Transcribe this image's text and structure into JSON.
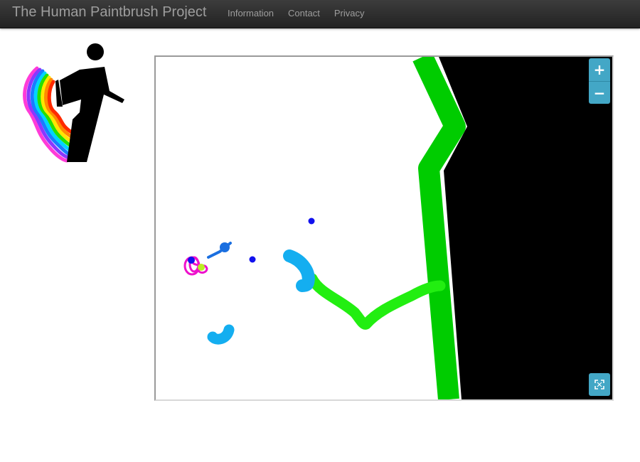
{
  "navbar": {
    "brand": "The Human Paintbrush Project",
    "links": [
      "Information",
      "Contact",
      "Privacy"
    ]
  },
  "logo": {
    "icon": "walking-person-rainbow-trail-icon"
  },
  "canvas": {
    "colors": {
      "background": "#ffffff",
      "dark_region": "#000000",
      "green_stroke": "#00cc00",
      "lime_stroke": "#22ee11",
      "light_blue": "#14aef0",
      "blue": "#1a6fe0",
      "dark_blue": "#1111ee",
      "magenta": "#ee11cc",
      "yellow_green": "#bbee22"
    }
  },
  "controls": {
    "zoom_in": "+",
    "zoom_out": "−",
    "zoom_in_icon": "plus-icon",
    "zoom_out_icon": "minus-icon",
    "fullscreen_icon": "fullscreen-icon",
    "accent": "#43a7c6"
  }
}
